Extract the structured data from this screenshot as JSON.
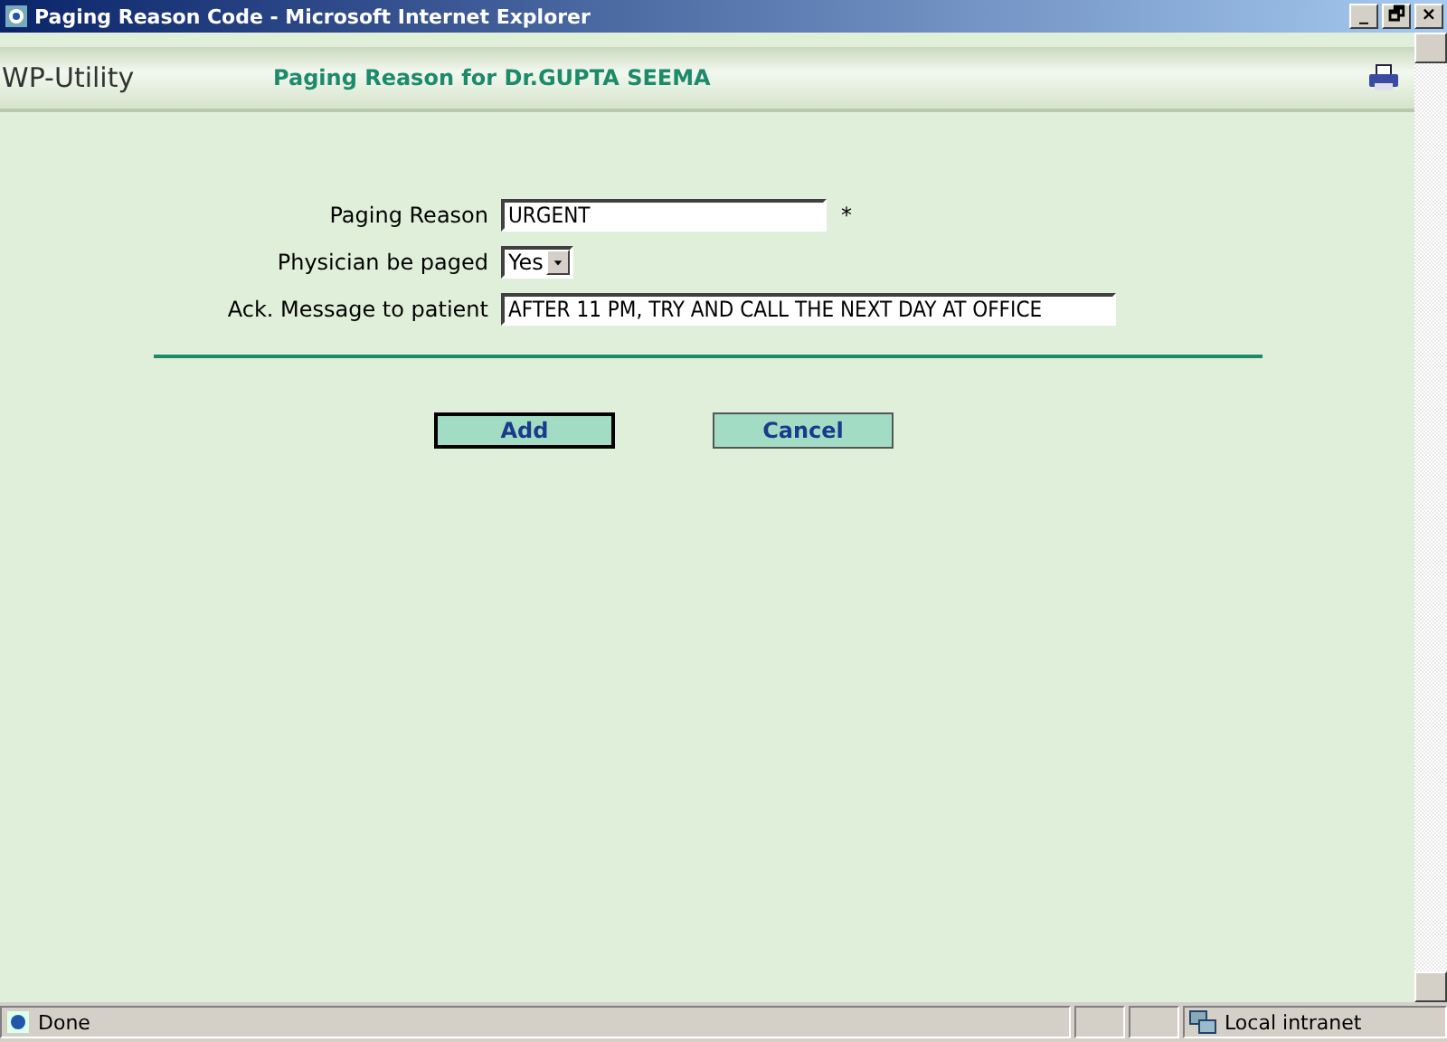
{
  "window": {
    "title": "Paging Reason Code - Microsoft Internet Explorer",
    "controls": [
      "_",
      "🗗",
      "×"
    ]
  },
  "header": {
    "app_name": "WP-Utility",
    "page_title": "Paging Reason for Dr.GUPTA SEEMA"
  },
  "form": {
    "fields": [
      {
        "kind": "text",
        "label": "Paging Reason",
        "value": "URGENT",
        "required_mark": "*"
      },
      {
        "kind": "select",
        "label": "Physician be paged",
        "value": "Yes"
      },
      {
        "kind": "wide-text",
        "label": "Ack. Message to patient",
        "value": "AFTER 11 PM, TRY AND CALL THE NEXT DAY AT OFFICE"
      }
    ],
    "buttons": [
      {
        "label": "Add",
        "focused": true
      },
      {
        "label": "Cancel",
        "focused": false
      }
    ]
  },
  "status_bar": {
    "text": "Done",
    "zone": "Local intranet"
  }
}
